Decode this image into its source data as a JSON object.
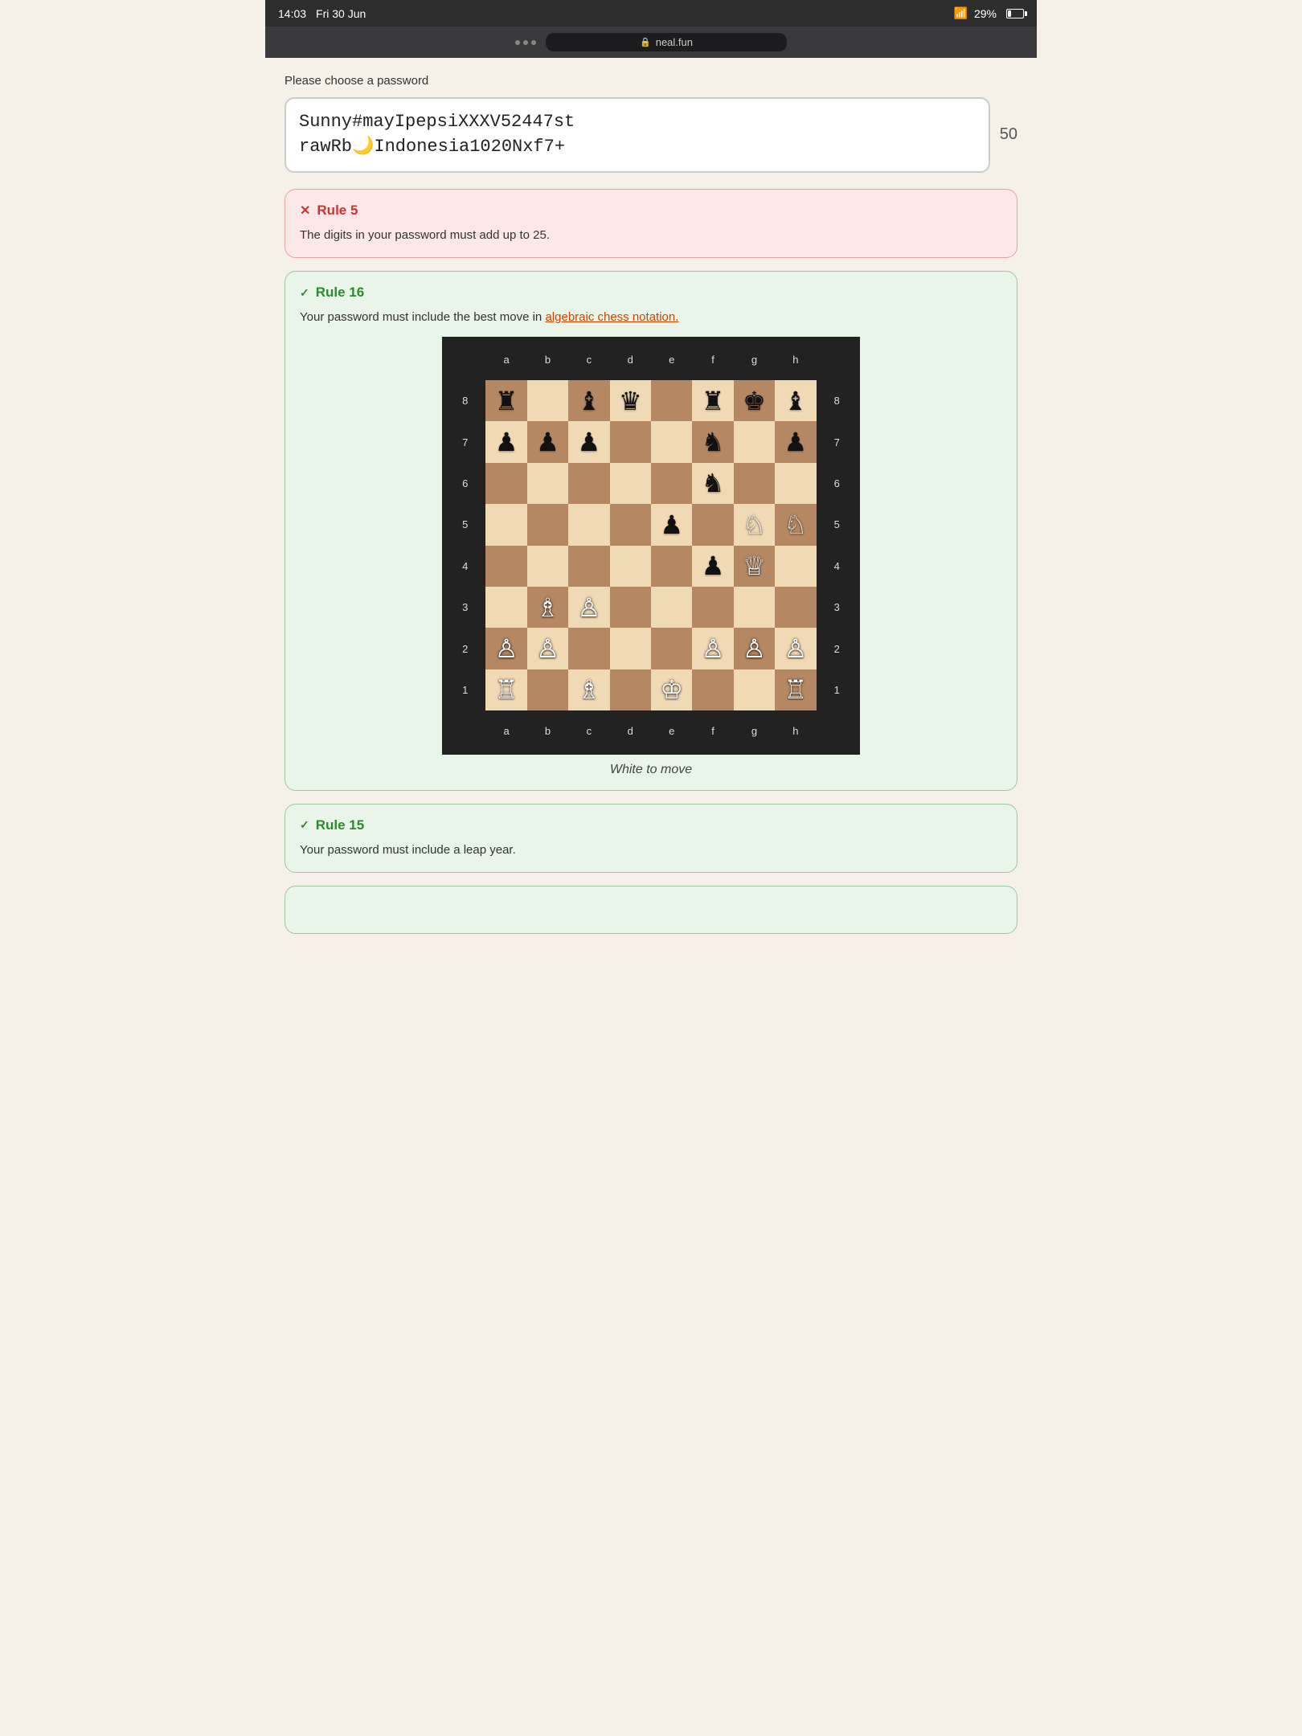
{
  "statusBar": {
    "time": "14:03",
    "date": "Fri 30 Jun",
    "battery": "29%",
    "dots": [
      "•",
      "•",
      "•"
    ]
  },
  "browser": {
    "url": "neal.fun",
    "lockLabel": "🔒"
  },
  "page": {
    "choosePasswordLabel": "Please choose a password",
    "passwordValue": "Sunny#mayIpepsiXXXV52447strawRb🌙Indonesia1020Nxf7+",
    "passwordDisplayLine1": "Sunny#mayIpepsiXXXV52447st",
    "passwordDisplayLine2": "rawRb🌙Indonesia1020Nxf7+",
    "passwordCount": "50"
  },
  "rules": {
    "rule5": {
      "number": "Rule 5",
      "status": "fail",
      "iconFail": "✕",
      "body": "The digits in your password must add up to 25."
    },
    "rule16": {
      "number": "Rule 16",
      "status": "pass",
      "iconPass": "✓",
      "bodyBefore": "Your password must include the best move in ",
      "linkText": "algebraic chess notation.",
      "caption": "White to move"
    },
    "rule15": {
      "number": "Rule 15",
      "status": "pass",
      "iconPass": "✓",
      "body": "Your password must include a leap year."
    }
  }
}
